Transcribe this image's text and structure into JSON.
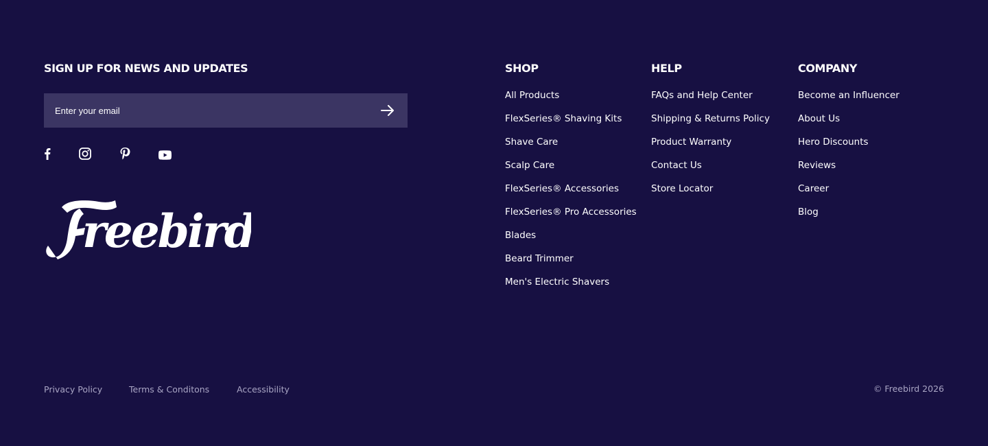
{
  "newsletter": {
    "heading": "SIGN UP FOR NEWS AND UPDATES",
    "email_placeholder": "Enter your email",
    "submit_icon": "arrow-right-icon"
  },
  "social_links": [
    {
      "name": "facebook",
      "icon": "facebook-icon"
    },
    {
      "name": "instagram",
      "icon": "instagram-icon"
    },
    {
      "name": "pinterest",
      "icon": "pinterest-icon"
    },
    {
      "name": "youtube",
      "icon": "youtube-icon"
    }
  ],
  "logo": {
    "text": "Freebird"
  },
  "columns": {
    "shop": {
      "heading": "SHOP",
      "links": [
        "All Products",
        "FlexSeries® Shaving Kits",
        "Shave Care",
        "Scalp Care",
        "FlexSeries® Accessories",
        "FlexSeries® Pro Accessories",
        "Blades",
        "Beard Trimmer",
        "Men's Electric Shavers"
      ]
    },
    "help": {
      "heading": "HELP",
      "links": [
        "FAQs and Help Center",
        "Shipping & Returns Policy",
        "Product Warranty",
        "Contact Us",
        "Store Locator"
      ]
    },
    "company": {
      "heading": "COMPANY",
      "links": [
        "Become an Influencer",
        "About Us",
        "Hero Discounts",
        "Reviews",
        "Career",
        "Blog"
      ]
    }
  },
  "legal": {
    "privacy": "Privacy Policy",
    "terms": "Terms & Conditons",
    "accessibility": "Accessibility"
  },
  "copyright": "© Freebird 2026",
  "colors": {
    "background": "#171042",
    "input_background": "#3b3563",
    "text": "#ffffff",
    "muted_text": "#a9a5c4"
  }
}
